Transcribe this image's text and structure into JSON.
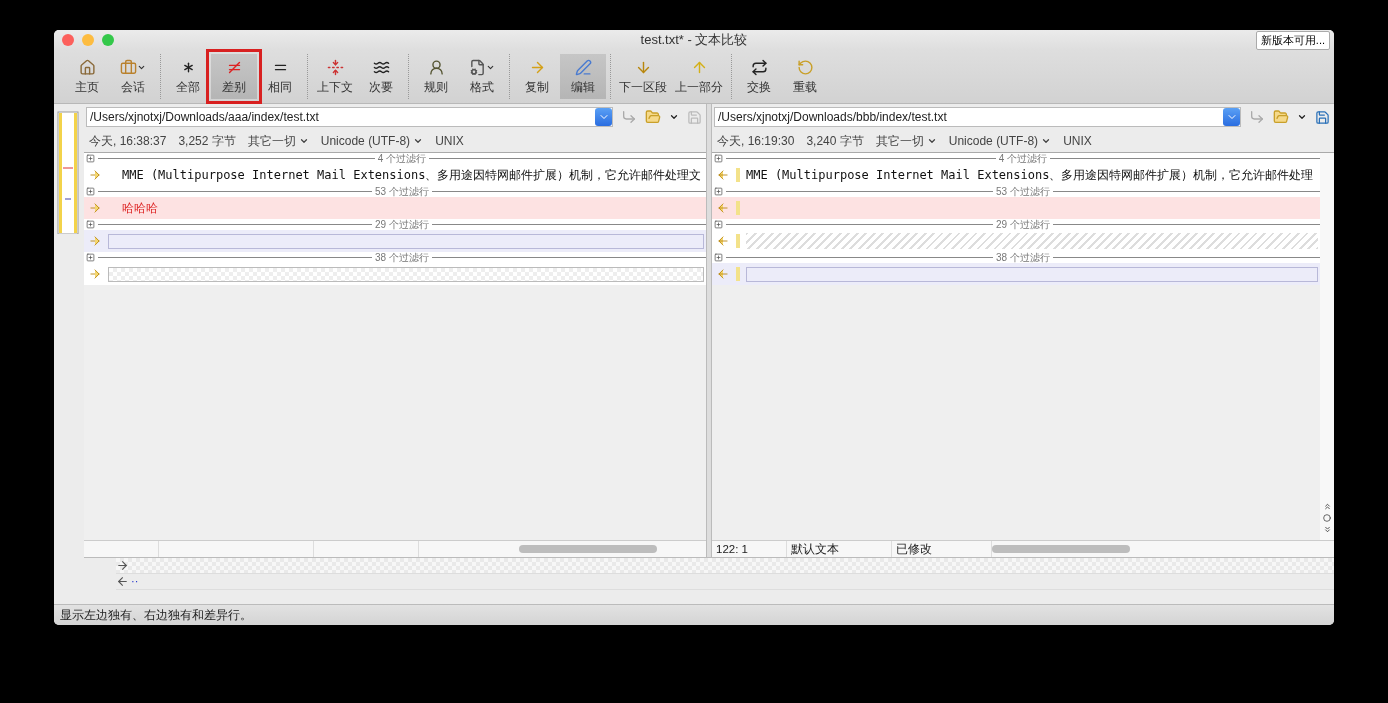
{
  "window": {
    "title": "test.txt* - 文本比较",
    "update_button": "新版本可用..."
  },
  "toolbar": {
    "groups": [
      [
        {
          "label": "主页",
          "selected": false,
          "marked": false,
          "menu": false
        },
        {
          "label": "会话",
          "selected": false,
          "marked": false,
          "menu": true
        }
      ],
      [
        {
          "label": "全部",
          "selected": false,
          "marked": false,
          "menu": false
        },
        {
          "label": "差别",
          "selected": true,
          "marked": true,
          "menu": false
        },
        {
          "label": "相同",
          "selected": false,
          "marked": false,
          "menu": false
        }
      ],
      [
        {
          "label": "上下文",
          "selected": false,
          "marked": false,
          "menu": false
        },
        {
          "label": "次要",
          "selected": false,
          "marked": false,
          "menu": false
        }
      ],
      [
        {
          "label": "规则",
          "selected": false,
          "marked": false,
          "menu": false
        },
        {
          "label": "格式",
          "selected": false,
          "marked": false,
          "menu": true
        }
      ],
      [
        {
          "label": "复制",
          "selected": false,
          "marked": false,
          "menu": false
        },
        {
          "label": "编辑",
          "selected": true,
          "marked": false,
          "menu": false
        }
      ],
      [
        {
          "label": "下一区段",
          "selected": false,
          "marked": false,
          "menu": false
        },
        {
          "label": "上一部分",
          "selected": false,
          "marked": false,
          "menu": false
        }
      ],
      [
        {
          "label": "交换",
          "selected": false,
          "marked": false,
          "menu": false
        },
        {
          "label": "重载",
          "selected": false,
          "marked": false,
          "menu": false
        }
      ]
    ]
  },
  "panes": [
    {
      "path": "/Users/xjnotxj/Downloads/aaa/index/test.txt",
      "date": "今天, 16:38:37",
      "size": "3,252 字节",
      "filter": "其它一切",
      "encoding": "Unicode (UTF-8)",
      "line_end": "UNIX",
      "save_enabled": false,
      "rows": [
        {
          "filtered": "4 个过滤行",
          "kind": "same",
          "text": "MME (Multipurpose Internet Mail Extensions、多用途因特网邮件扩展）机制，它允许邮件处理文"
        },
        {
          "filtered": "53 个过滤行",
          "kind": "changed",
          "text": "哈哈哈"
        },
        {
          "filtered": "29 个过滤行",
          "kind": "orphan"
        },
        {
          "filtered": "38 个过滤行",
          "kind": "missing"
        }
      ]
    },
    {
      "path": "/Users/xjnotxj/Downloads/bbb/index/test.txt",
      "date": "今天, 16:19:30",
      "size": "3,240 字节",
      "filter": "其它一切",
      "encoding": "Unicode (UTF-8)",
      "line_end": "UNIX",
      "save_enabled": true,
      "rows": [
        {
          "filtered": "4 个过滤行",
          "kind": "same",
          "text": "MME (Multipurpose Internet Mail Extensions、多用途因特网邮件扩展）机制，它允许邮件处理"
        },
        {
          "filtered": "53 个过滤行",
          "kind": "changed"
        },
        {
          "filtered": "29 个过滤行",
          "kind": "missing"
        },
        {
          "filtered": "38 个过滤行",
          "kind": "orphan"
        }
      ],
      "status": [
        "122: 1",
        "默认文本",
        "已修改"
      ]
    }
  ],
  "compare_lines": [
    {
      "kind": "right"
    },
    {
      "kind": "left",
      "text": "··"
    }
  ],
  "status_bar": "显示左边独有、右边独有和差异行。"
}
